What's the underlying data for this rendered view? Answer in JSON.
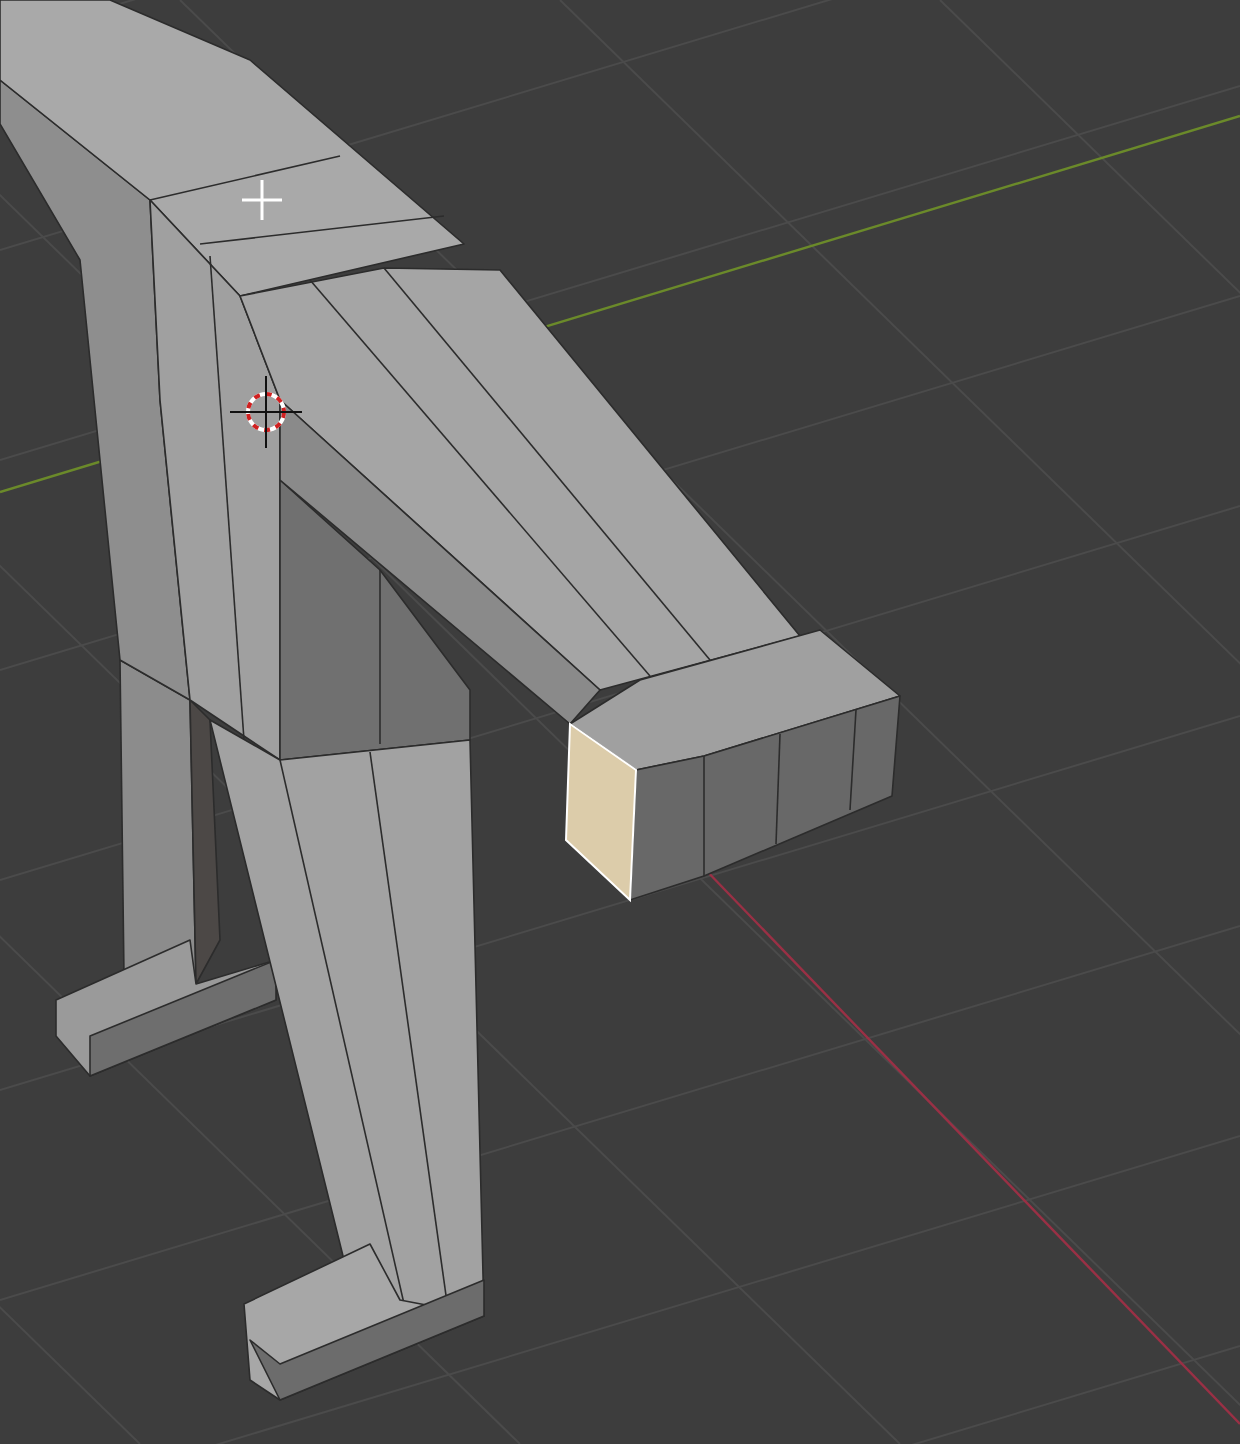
{
  "viewport": {
    "end_face": {
      "selected": true
    }
  }
}
